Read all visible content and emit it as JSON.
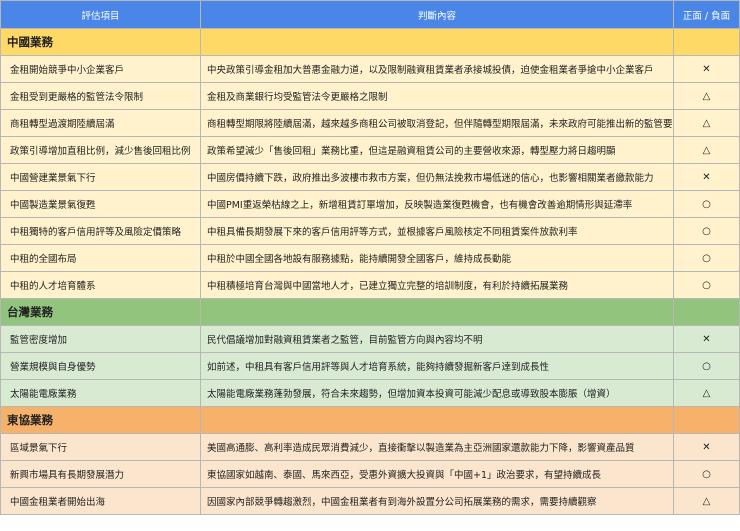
{
  "header": {
    "item": "評估項目",
    "judgment": "判斷內容",
    "impact": "正面 / 負面"
  },
  "sections": [
    {
      "title": "中國業務",
      "rows": [
        {
          "item": "金租開始競爭中小企業客戶",
          "judgment": "中央政策引導金租加大普惠金融力道，以及限制融資租賃業者承接城投債，迫使金租業者爭搶中小企業客戶",
          "impact": "✕"
        },
        {
          "item": "金租受到更嚴格的監管法令限制",
          "judgment": "金租及商業銀行均受監管法令更嚴格之限制",
          "impact": "△"
        },
        {
          "item": "商租轉型過渡期陸續屆滿",
          "judgment": "商租轉型期限將陸續屆滿，越來越多商租公司被取消登記，但伴隨轉型期限屆滿，未來政府可能推出新的監管要求",
          "impact": "△"
        },
        {
          "item": "政策引導增加直租比例，減少售後回租比例",
          "judgment": "政策希望減少「售後回租」業務比重，但這是融資租賃公司的主要營收來源，轉型壓力將日趨明顯",
          "impact": "△"
        },
        {
          "item": "中國營建業景氣下行",
          "judgment": "中國房價持續下跌，政府推出多波樓市救市方案，但仍無法挽救市場低迷的信心，也影響相關業者繳款能力",
          "impact": "✕"
        },
        {
          "item": "中國製造業景氣復甦",
          "judgment": "中國PMI重返榮枯線之上，新增租賃訂單增加，反映製造業復甦機會，也有機會改善逾期情形與延滯率",
          "impact": "○"
        },
        {
          "item": "中租獨特的客戶信用評等及風險定價策略",
          "judgment": "中租具備長期發展下來的客戶信用評等方式，並根據客戶風險核定不同租賃案件放款利率",
          "impact": "○"
        },
        {
          "item": "中租的全國布局",
          "judgment": "中租於中國全國各地設有服務據點，能持續開發全國客戶，維持成長動能",
          "impact": "○"
        },
        {
          "item": "中租的人才培育體系",
          "judgment": "中租積極培育台灣與中國當地人才，已建立獨立完整的培訓制度，有利於持續拓展業務",
          "impact": "○"
        }
      ]
    },
    {
      "title": "台灣業務",
      "rows": [
        {
          "item": "監管密度增加",
          "judgment": "民代倡議增加對融資租賃業者之監管，目前監管方向與內容均不明",
          "impact": "✕"
        },
        {
          "item": "營業規模與自身優勢",
          "judgment": "如前述，中租具有客戶信用評等與人才培育系統，能夠持續發掘新客戶達到成長性",
          "impact": "○"
        },
        {
          "item": "太陽能電廠業務",
          "judgment": "太陽能電廠業務蓬勃發展，符合未來趨勢，但增加資本投資可能減少配息或導致股本膨脹（增資）",
          "impact": "△"
        }
      ]
    },
    {
      "title": "東協業務",
      "rows": [
        {
          "item": "區域景氣下行",
          "judgment": "美國高通膨、高利率造成民眾消費減少，直接衝擊以製造業為主亞洲國家還款能力下降，影響資產品質",
          "impact": "✕"
        },
        {
          "item": "新興市場具有長期發展潛力",
          "judgment": "東協國家如越南、泰國、馬來西亞，受惠外資擴大投資與「中國+1」政治要求，有望持續成長",
          "impact": "○"
        },
        {
          "item": "中國金租業者開始出海",
          "judgment": "因國家內部競爭轉趨激烈，中國金租業者有到海外設置分公司拓展業務的需求，需要持續觀察",
          "impact": "△"
        }
      ]
    }
  ]
}
